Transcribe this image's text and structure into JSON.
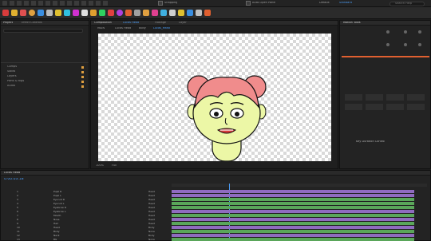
{
  "toolbar": {
    "default_label": "Default",
    "learn_label": "Learn",
    "standard_label": "Standard",
    "libraries_label": "Libraries",
    "search_label": "Search Help",
    "snapping_label": "Snapping",
    "auto_open_label": "Auto-Open Panel"
  },
  "panels": {
    "project_tab": "Project",
    "effect_controls_tab": "Effect Controls",
    "composition_tab": "Composition",
    "comp_name": "Lucas Head",
    "footage_tab": "Footage",
    "layer_tab": "Layer"
  },
  "project": {
    "items": [
      {
        "name": "Comps",
        "color": "#e0a040"
      },
      {
        "name": "Solids",
        "color": "#e0a040"
      },
      {
        "name": "Layers",
        "color": "#e0a040"
      },
      {
        "name": "Parts & Rigs",
        "color": "#e0a040"
      },
      {
        "name": "Audio",
        "color": "#e0a040"
      }
    ]
  },
  "viewer": {
    "breadcrumbs": [
      "MAIN",
      "Lucas Head",
      "Body",
      "Lucas_Head"
    ],
    "zoom": "Full",
    "magnification": "100%"
  },
  "right": {
    "panel_title": "Motion Tools",
    "effects_title": "Align",
    "time_remaining_title": "Key Duration Control"
  },
  "timeline": {
    "time": "0:00:03:18",
    "comp_tab": "Lucas Head",
    "layers": [
      {
        "num": "1",
        "name": "Pupil R",
        "parent": "Head",
        "color": "#e07dd0"
      },
      {
        "num": "2",
        "name": "Pupil L",
        "parent": "Head",
        "color": "#e07dd0"
      },
      {
        "num": "3",
        "name": "Eye Lid R",
        "parent": "Head",
        "color": "#7ad0e0"
      },
      {
        "num": "4",
        "name": "Eye Lid L",
        "parent": "Head",
        "color": "#7ad0e0"
      },
      {
        "num": "5",
        "name": "Eyebrow R",
        "parent": "Head",
        "color": "#e0a040"
      },
      {
        "num": "6",
        "name": "Eyebrow L",
        "parent": "Head",
        "color": "#e0a040"
      },
      {
        "num": "7",
        "name": "Mouth",
        "parent": "Head",
        "color": "#9a7ae0"
      },
      {
        "num": "8",
        "name": "Nose",
        "parent": "Head",
        "color": "#7ad07a"
      },
      {
        "num": "9",
        "name": "Hair",
        "parent": "Head",
        "color": "#e0a040"
      },
      {
        "num": "10",
        "name": "Head",
        "parent": "Body",
        "color": "#7ad0e0"
      },
      {
        "num": "11",
        "name": "Body",
        "parent": "None",
        "color": "#e07dd0"
      },
      {
        "num": "12",
        "name": "Neck",
        "parent": "Body",
        "color": "#9a7ae0"
      },
      {
        "num": "13",
        "name": "BG",
        "parent": "None",
        "color": "#7ad07a"
      }
    ]
  },
  "colors": {
    "accent": "#4b9cf5",
    "track_purple": "#8f6bbf",
    "track_green": "#5aa65a",
    "skin": "#ecf7a6",
    "hair": "#f08c8c"
  }
}
